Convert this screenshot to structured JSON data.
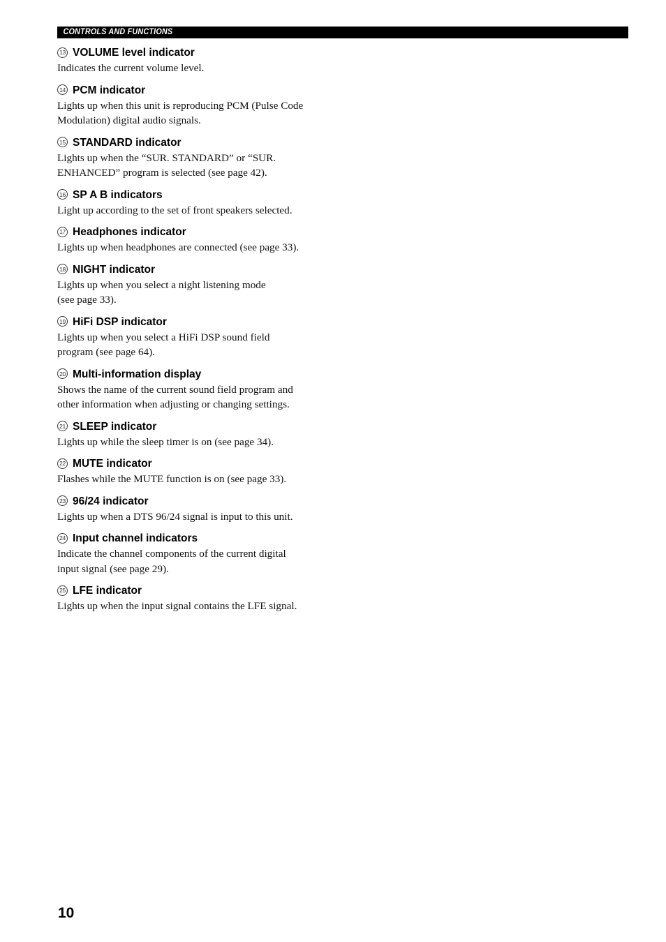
{
  "header": {
    "section_label": "CONTROLS AND FUNCTIONS"
  },
  "page_number": "10",
  "entries": [
    {
      "number": "13",
      "heading": "VOLUME level indicator",
      "lines": [
        "Indicates the current volume level."
      ]
    },
    {
      "number": "14",
      "heading": "PCM indicator",
      "lines": [
        "Lights up when this unit is reproducing PCM (Pulse Code",
        "Modulation) digital audio signals."
      ]
    },
    {
      "number": "15",
      "heading": "STANDARD indicator",
      "lines": [
        "Lights up when the “SUR. STANDARD” or “SUR.",
        "ENHANCED” program is selected (see page 42)."
      ]
    },
    {
      "number": "16",
      "heading": "SP A B indicators",
      "lines": [
        "Light up according to the set of front speakers selected."
      ]
    },
    {
      "number": "17",
      "heading": "Headphones indicator",
      "lines": [
        "Lights up when headphones are connected (see page 33)."
      ]
    },
    {
      "number": "18",
      "heading": "NIGHT indicator",
      "lines": [
        "Lights up when you select a night listening mode",
        "(see page 33)."
      ]
    },
    {
      "number": "19",
      "heading": "HiFi DSP indicator",
      "lines": [
        "Lights up when you select a HiFi DSP sound field",
        "program (see page 64)."
      ]
    },
    {
      "number": "20",
      "heading": "Multi-information display",
      "lines": [
        "Shows the name of the current sound field program and",
        "other information when adjusting or changing settings."
      ]
    },
    {
      "number": "21",
      "heading": "SLEEP indicator",
      "lines": [
        "Lights up while the sleep timer is on (see page 34)."
      ]
    },
    {
      "number": "22",
      "heading": "MUTE indicator",
      "lines": [
        "Flashes while the MUTE function is on (see page 33)."
      ]
    },
    {
      "number": "23",
      "heading": "96/24 indicator",
      "lines": [
        "Lights up when a DTS 96/24 signal is input to this unit."
      ]
    },
    {
      "number": "24",
      "heading": "Input channel indicators",
      "lines": [
        "Indicate the channel components of the current digital",
        "input signal (see page 29)."
      ]
    },
    {
      "number": "25",
      "heading": "LFE indicator",
      "lines": [
        "Lights up when the input signal contains the LFE signal."
      ]
    }
  ]
}
